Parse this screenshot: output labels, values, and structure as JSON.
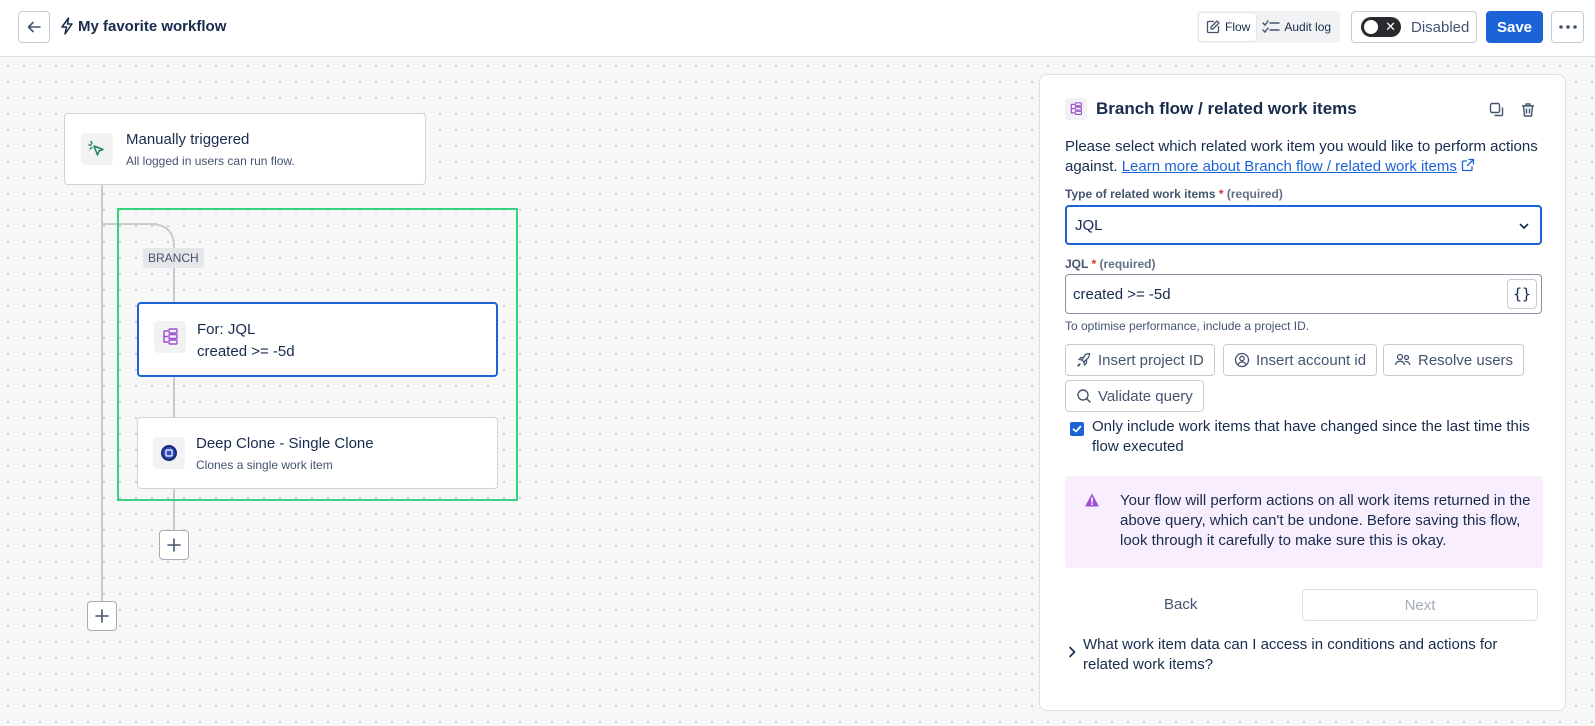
{
  "header": {
    "title": "My favorite workflow",
    "tabs": [
      {
        "label": "Flow",
        "active": true
      },
      {
        "label": "Audit log",
        "active": false
      }
    ],
    "toggle_label": "Disabled",
    "save_label": "Save"
  },
  "canvas": {
    "trigger": {
      "title": "Manually triggered",
      "subtitle": "All logged in users can run flow."
    },
    "branch_label": "BRANCH",
    "branch_node": {
      "title": "For: JQL",
      "subtitle": "created >= -5d"
    },
    "action_node": {
      "title": "Deep Clone - Single Clone",
      "subtitle": "Clones a single work item"
    }
  },
  "panel": {
    "title": "Branch flow / related work items",
    "description": "Please select which related work item you would like to perform actions against.",
    "learn_more": "Learn more about Branch flow / related work items",
    "type_label": "Type of related work items",
    "required_marker": "*",
    "required_text": "(required)",
    "type_value": "JQL",
    "jql_label": "JQL",
    "jql_value": "created >= -5d",
    "hint": "To optimise performance, include a project ID.",
    "chips": [
      "Insert project ID",
      "Insert account id",
      "Resolve users",
      "Validate query"
    ],
    "checkbox_label": "Only include work items that have changed since the last time this flow executed",
    "checkbox_checked": true,
    "warning": "Your flow will perform actions on all work items returned in the above query, which can't be undone. Before saving this flow, look through it carefully to make sure this is okay.",
    "back_label": "Back",
    "next_label": "Next",
    "faq": "What work item data can I access in conditions and actions for related work items?"
  },
  "colors": {
    "primary": "#1d63d8",
    "branch_highlight": "#35d27f",
    "warning_bg": "#f8eefe",
    "warning_icon": "#9f4fd2"
  }
}
